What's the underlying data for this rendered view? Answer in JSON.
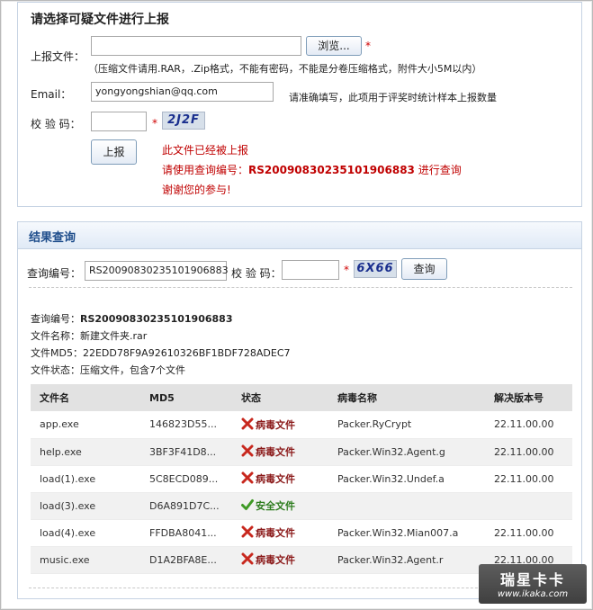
{
  "upload": {
    "title": "请选择可疑文件进行上报",
    "file_label": "上报文件：",
    "browse_button": "浏览...",
    "required_mark": "*",
    "file_hint": "（压缩文件请用.RAR，.Zip格式，不能有密码，不能是分卷压缩格式，附件大小5M以内）",
    "email_label": "Email：",
    "email_value": "yongyongshian@qq.com",
    "email_hint": "请准确填写，此项用于评奖时统计样本上报数量",
    "captcha_label": "校 验 码：",
    "captcha_text": "2J2F",
    "submit_button": "上报",
    "msg_line1": "此文件已经被上报",
    "msg_line2_prefix": "请使用查询编号：",
    "msg_query_id": "RS20090830235101906883",
    "msg_line2_suffix": " 进行查询",
    "msg_line3": "谢谢您的参与!"
  },
  "result": {
    "title": "结果查询",
    "query_label": "查询编号：",
    "query_value": "RS20090830235101906883",
    "captcha_label": "校 验 码：",
    "required_mark": "*",
    "captcha_text": "6X66",
    "query_button": "查询",
    "info": {
      "id_label": "查询编号：",
      "id_value": "RS20090830235101906883",
      "name_label": "文件名称：",
      "name_value": "新建文件夹.rar",
      "md5_label": "文件MD5：",
      "md5_value": "22EDD78F9A92610326BF1BDF728ADEC7",
      "status_label": "文件状态：",
      "status_value": "压缩文件，包含7个文件"
    },
    "table": {
      "headers": [
        "文件名",
        "MD5",
        "状态",
        "病毒名称",
        "解决版本号"
      ],
      "rows": [
        {
          "file": "app.exe",
          "md5": "146823D55...",
          "status": "病毒文件",
          "status_type": "virus",
          "virus": "Packer.RyCrypt",
          "version": "22.11.00.00"
        },
        {
          "file": "help.exe",
          "md5": "3BF3F41D8...",
          "status": "病毒文件",
          "status_type": "virus",
          "virus": "Packer.Win32.Agent.g",
          "version": "22.11.00.00"
        },
        {
          "file": "load(1).exe",
          "md5": "5C8ECD089...",
          "status": "病毒文件",
          "status_type": "virus",
          "virus": "Packer.Win32.Undef.a",
          "version": "22.11.00.00"
        },
        {
          "file": "load(3).exe",
          "md5": "D6A891D7C...",
          "status": "安全文件",
          "status_type": "safe",
          "virus": "",
          "version": ""
        },
        {
          "file": "load(4).exe",
          "md5": "FFDBA8041...",
          "status": "病毒文件",
          "status_type": "virus",
          "virus": "Packer.Win32.Mian007.a",
          "version": "22.11.00.00"
        },
        {
          "file": "music.exe",
          "md5": "D1A2BFA8E...",
          "status": "病毒文件",
          "status_type": "virus",
          "virus": "Packer.Win32.Agent.r",
          "version": "22.11.00.00"
        }
      ]
    }
  },
  "watermark": {
    "logo": "瑞星卡卡",
    "url": "www.ikaka.com"
  }
}
